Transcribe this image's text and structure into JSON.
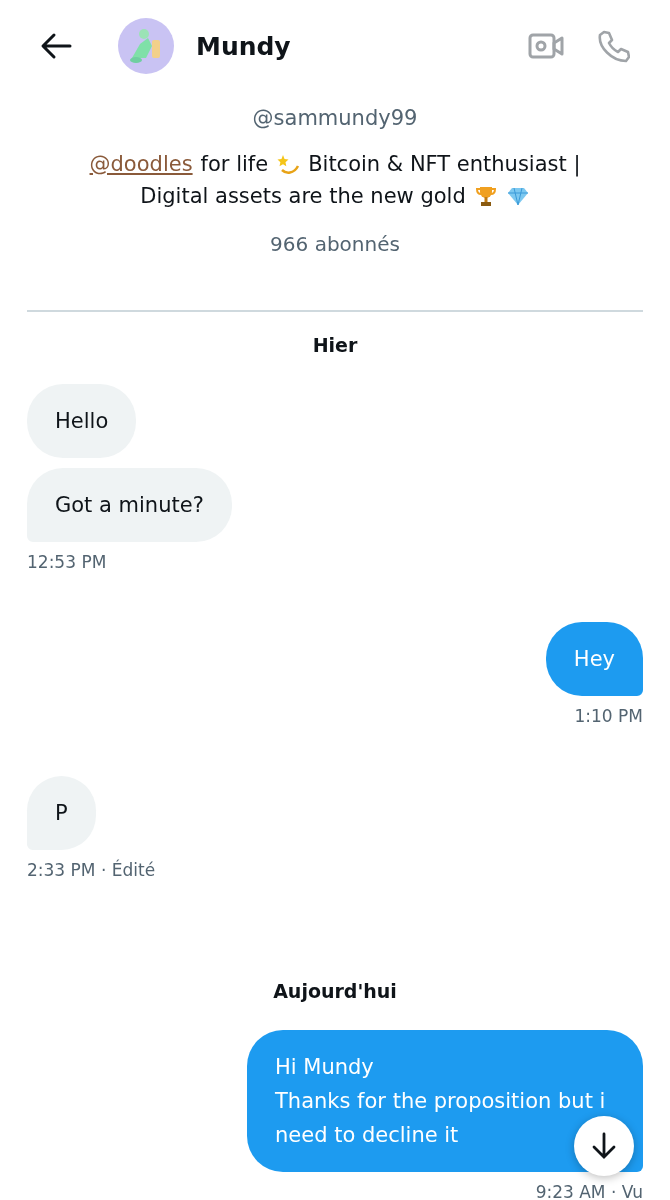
{
  "header": {
    "name": "Mundy"
  },
  "profile": {
    "handle": "@sammundy99",
    "bio": {
      "mention": "@doodles",
      "part_1": "for life",
      "part_2": "Bitcoin & NFT enthusiast |",
      "part_3": "Digital assets are the new gold"
    },
    "followers": "966 abonnés"
  },
  "messages": [
    {
      "kind": "date",
      "text": "Hier"
    },
    {
      "kind": "received",
      "text": "Hello",
      "tail": false
    },
    {
      "kind": "received",
      "text": "Got a minute?",
      "tail": true,
      "time": "12:53 PM"
    },
    {
      "kind": "sent",
      "text": "Hey",
      "tail": true,
      "time": "1:10 PM"
    },
    {
      "kind": "received",
      "text": "P",
      "tail": true,
      "time": "2:33 PM · Édité"
    },
    {
      "kind": "date",
      "text": "Aujourd'hui"
    },
    {
      "kind": "sent",
      "text": "Hi Mundy\nThanks for the proposition but i need to decline it",
      "tail": true,
      "time": "9:23 AM · Vu"
    }
  ]
}
